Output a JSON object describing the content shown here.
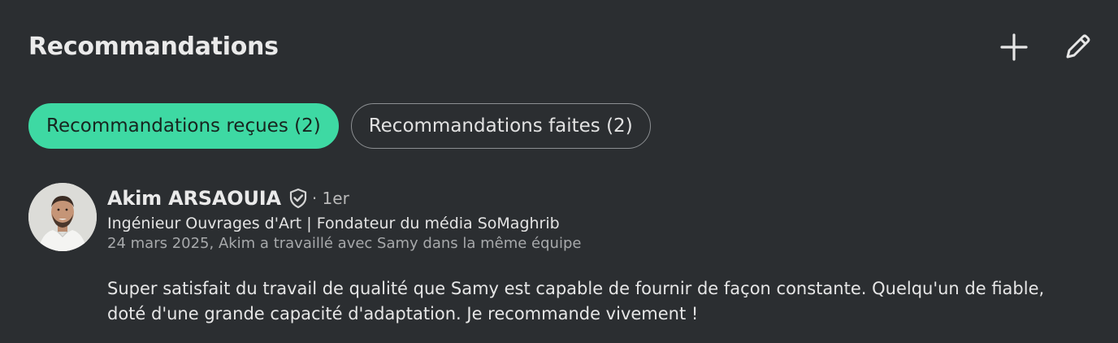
{
  "section": {
    "title": "Recommandations",
    "actions": {
      "add_icon": "plus-icon",
      "edit_icon": "pencil-icon"
    }
  },
  "tabs": [
    {
      "label": "Recommandations reçues (2)",
      "active": true
    },
    {
      "label": "Recommandations faites (2)",
      "active": false
    }
  ],
  "recommendation": {
    "name": "Akim ARSAOUIA",
    "verified_icon": "verified-shield-icon",
    "degree": "· 1er",
    "headline": "Ingénieur Ouvrages d'Art | Fondateur du média SoMaghrib",
    "meta": "24 mars 2025, Akim a travaillé avec Samy dans la même équipe",
    "text": "Super satisfait du travail de qualité que Samy est capable de fournir de façon constante. Quelqu'un de fiable, doté d'une grande capacité d'adaptation. Je recommande vivement !"
  },
  "colors": {
    "background": "#2b2e31",
    "accent": "#3ed9a3"
  }
}
